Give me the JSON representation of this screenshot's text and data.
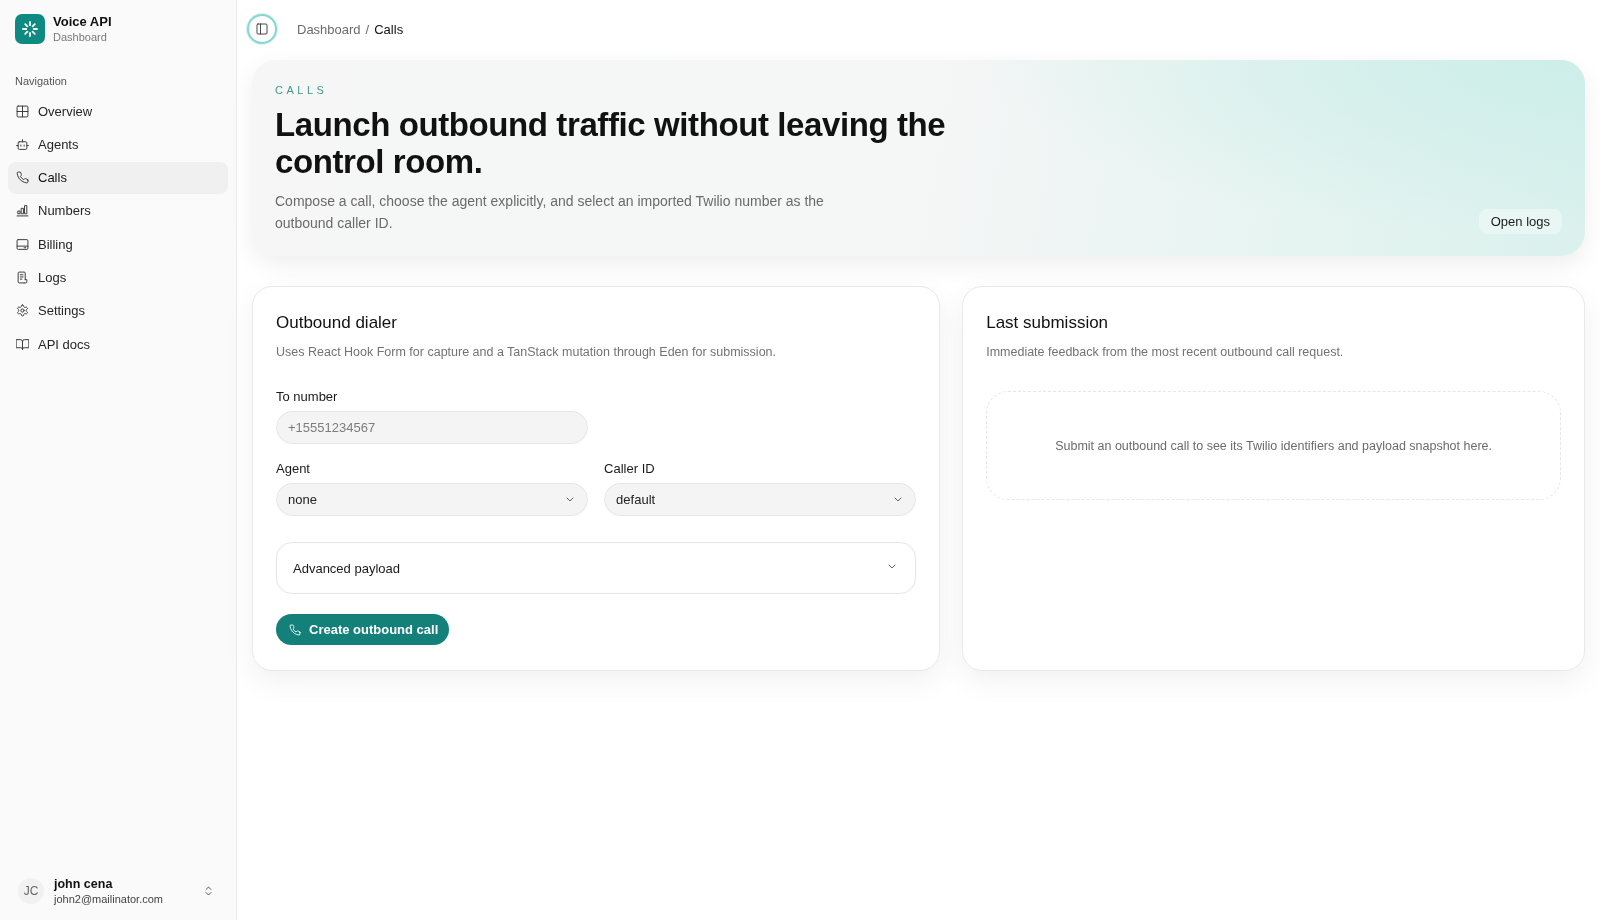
{
  "sidebar": {
    "brand": {
      "title": "Voice API",
      "subtitle": "Dashboard"
    },
    "section_label": "Navigation",
    "items": [
      {
        "label": "Overview",
        "selected": false
      },
      {
        "label": "Agents",
        "selected": false
      },
      {
        "label": "Calls",
        "selected": true
      },
      {
        "label": "Numbers",
        "selected": false
      },
      {
        "label": "Billing",
        "selected": false
      },
      {
        "label": "Logs",
        "selected": false
      },
      {
        "label": "Settings",
        "selected": false
      },
      {
        "label": "API docs",
        "selected": false
      }
    ],
    "user": {
      "initials": "JC",
      "name": "john cena",
      "email": "john2@mailinator.com"
    }
  },
  "header": {
    "separator": "/",
    "breadcrumb": [
      {
        "label": "Dashboard",
        "current": false
      },
      {
        "label": "Calls",
        "current": true
      }
    ]
  },
  "hero": {
    "eyebrow": "CALLS",
    "title": "Launch outbound traffic without leaving the control room.",
    "description": "Compose a call, choose the agent explicitly, and select an imported Twilio number as the outbound caller ID.",
    "action": "Open logs"
  },
  "dialer": {
    "title": "Outbound dialer",
    "description": "Uses React Hook Form for capture and a TanStack mutation through Eden for submission.",
    "field_rows": [
      [
        {
          "kind": "input",
          "label": "To number",
          "placeholder": "+15551234567"
        }
      ],
      [
        {
          "kind": "select",
          "label": "Agent",
          "value": "none"
        },
        {
          "kind": "select",
          "label": "Caller ID",
          "value": "default"
        }
      ]
    ],
    "advanced": {
      "label": "Advanced payload",
      "expanded": false
    },
    "submit": "Create outbound call"
  },
  "last_submission": {
    "title": "Last submission",
    "description": "Immediate feedback from the most recent outbound call request.",
    "empty_message": "Submit an outbound call to see its Twilio identifiers and payload snapshot here."
  }
}
